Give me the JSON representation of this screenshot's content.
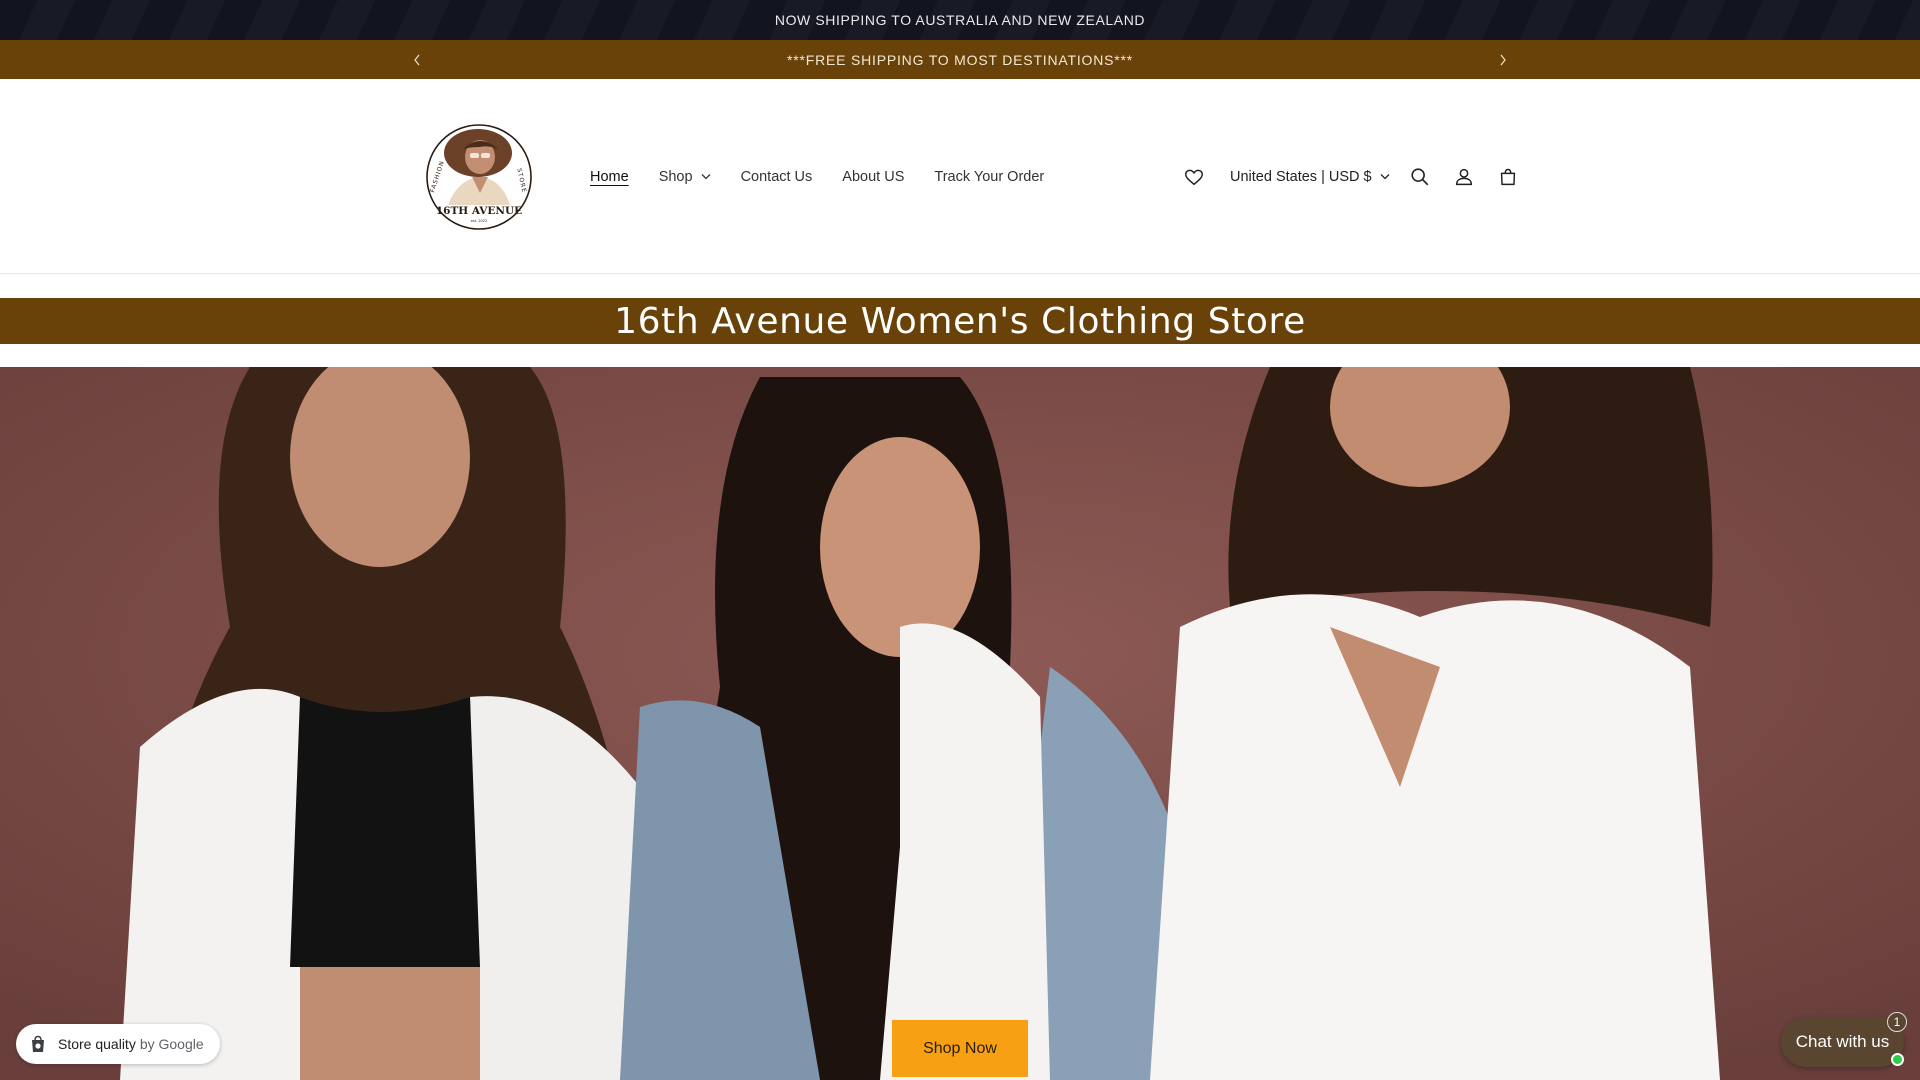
{
  "announcement": {
    "text": "NOW SHIPPING TO AUSTRALIA AND NEW ZEALAND"
  },
  "promo_bar": {
    "text": "***FREE SHIPPING TO MOST DESTINATIONS***",
    "prev_icon": "chevron-left-icon",
    "next_icon": "chevron-right-icon"
  },
  "logo": {
    "top_text": "FASHION",
    "side_text": "STORE",
    "name": "16TH AVENUE",
    "est": "est. 2022"
  },
  "nav": {
    "home": "Home",
    "shop": "Shop",
    "contact": "Contact Us",
    "about": "About US",
    "track": "Track Your Order"
  },
  "header_actions": {
    "wishlist_icon": "heart-icon",
    "locale": "United States | USD $",
    "search_icon": "search-icon",
    "account_icon": "user-icon",
    "cart_icon": "cart-icon"
  },
  "store_title": "16th Avenue Women's Clothing Store",
  "hero": {
    "cta": "Shop Now"
  },
  "badge": {
    "label": "Store quality",
    "by": "by Google"
  },
  "chat": {
    "label": "Chat with us",
    "count": "1"
  },
  "colors": {
    "brand_gold": "#684208",
    "cta_orange": "#f7a013",
    "topbar": "#121520",
    "chat_brown": "#5a4530"
  }
}
